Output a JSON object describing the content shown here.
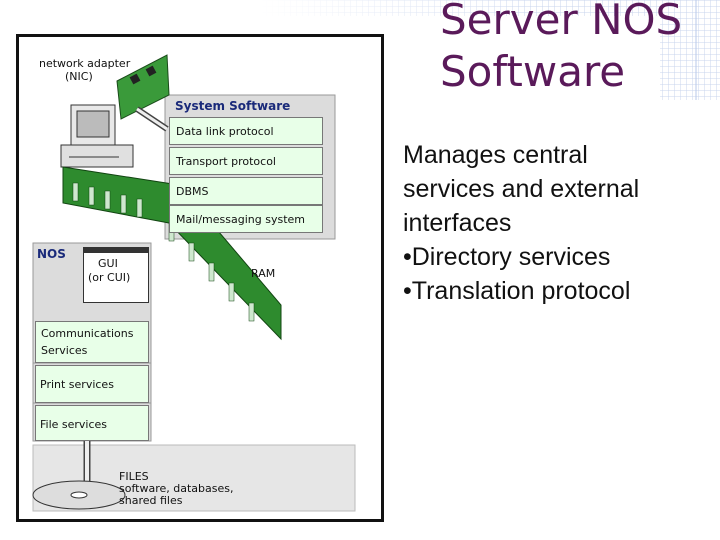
{
  "slide": {
    "title_line1": "Server NOS",
    "title_line2": "Software",
    "body": [
      "Manages central",
      "services and external",
      "interfaces",
      "•Directory services",
      "•Translation protocol"
    ]
  },
  "diagram": {
    "nic_label_1": "network adapter",
    "nic_label_2": "(NIC)",
    "system_software_title": "System Software",
    "system_layers": [
      "Data link protocol",
      "Transport protocol",
      "DBMS",
      "Mail/messaging system"
    ],
    "ram_label": "RAM",
    "nos_title": "NOS",
    "gui_label_1": "GUI",
    "gui_label_2": "(or CUI)",
    "nos_services": [
      [
        "Communications",
        "Services"
      ],
      [
        "Print services"
      ],
      [
        "File services"
      ]
    ],
    "files_label": "FILES",
    "files_desc_1": "software, databases,",
    "files_desc_2": "shared files"
  },
  "colors": {
    "title": "#5a1a5a",
    "box_fill": "#e8ffe8",
    "panel_fill": "#dcdcdc",
    "ram_green": "#2e8b2e"
  }
}
